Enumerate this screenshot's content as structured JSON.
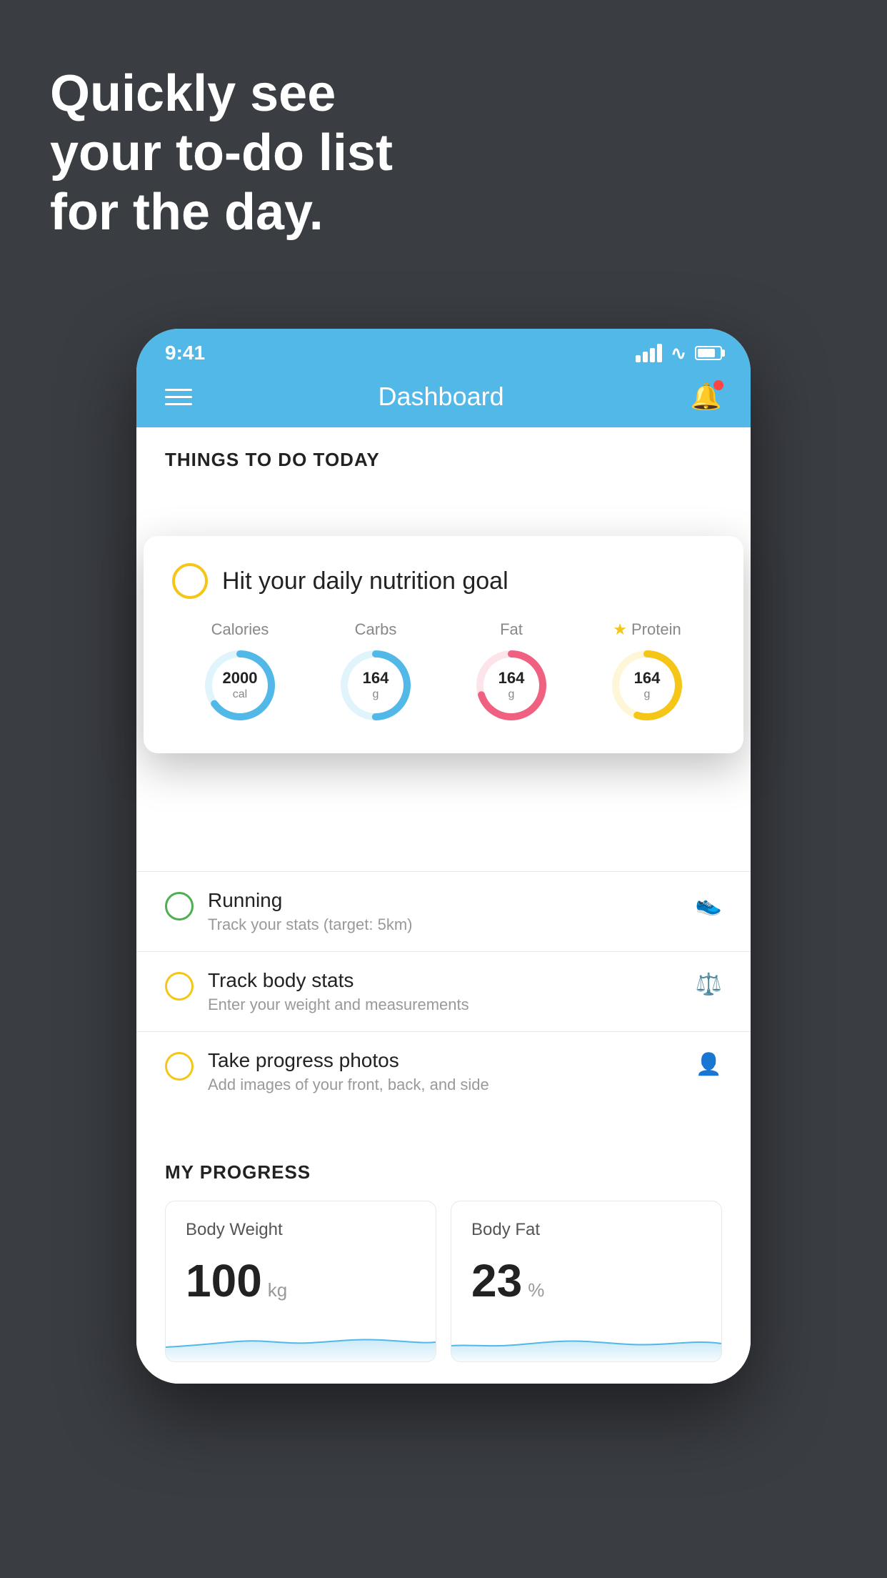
{
  "background_color": "#3a3d42",
  "headline": {
    "line1": "Quickly see",
    "line2": "your to-do list",
    "line3": "for the day."
  },
  "status_bar": {
    "time": "9:41"
  },
  "nav": {
    "title": "Dashboard"
  },
  "things_section": {
    "header": "THINGS TO DO TODAY"
  },
  "nutrition_card": {
    "title": "Hit your daily nutrition goal",
    "items": [
      {
        "label": "Calories",
        "value": "2000",
        "unit": "cal",
        "color": "#52b8e8",
        "track_color": "#e0f4fc",
        "percent": 65
      },
      {
        "label": "Carbs",
        "value": "164",
        "unit": "g",
        "color": "#52b8e8",
        "track_color": "#e0f4fc",
        "percent": 50
      },
      {
        "label": "Fat",
        "value": "164",
        "unit": "g",
        "color": "#f06080",
        "track_color": "#fce4ea",
        "percent": 70
      },
      {
        "label": "Protein",
        "value": "164",
        "unit": "g",
        "color": "#f5c518",
        "track_color": "#fef6d6",
        "percent": 55,
        "starred": true
      }
    ]
  },
  "todo_items": [
    {
      "title": "Running",
      "subtitle": "Track your stats (target: 5km)",
      "circle_color": "green",
      "icon": "👟"
    },
    {
      "title": "Track body stats",
      "subtitle": "Enter your weight and measurements",
      "circle_color": "yellow",
      "icon": "⚖"
    },
    {
      "title": "Take progress photos",
      "subtitle": "Add images of your front, back, and side",
      "circle_color": "yellow",
      "icon": "👤"
    }
  ],
  "progress_section": {
    "header": "MY PROGRESS",
    "cards": [
      {
        "title": "Body Weight",
        "value": "100",
        "unit": "kg"
      },
      {
        "title": "Body Fat",
        "value": "23",
        "unit": "%"
      }
    ]
  }
}
